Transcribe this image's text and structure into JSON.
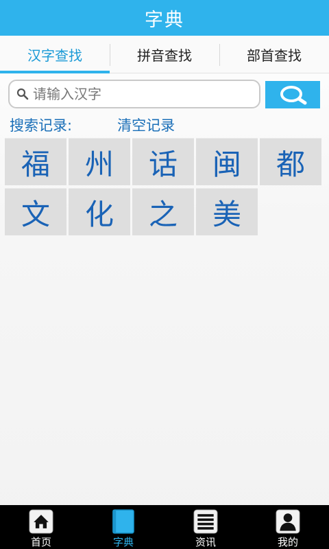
{
  "header": {
    "title": "字典"
  },
  "tabs": [
    {
      "label": "汉字查找",
      "active": true
    },
    {
      "label": "拼音查找",
      "active": false
    },
    {
      "label": "部首查找",
      "active": false
    }
  ],
  "search": {
    "placeholder": "请输入汉字",
    "value": ""
  },
  "history": {
    "label": "搜索记录:",
    "clear_label": "清空记录",
    "items": [
      "福",
      "州",
      "话",
      "闽",
      "都",
      "文",
      "化",
      "之",
      "美"
    ]
  },
  "bottom_nav": [
    {
      "label": "首页",
      "icon": "home-icon",
      "active": false
    },
    {
      "label": "字典",
      "icon": "dictionary-icon",
      "active": true
    },
    {
      "label": "资讯",
      "icon": "news-icon",
      "active": false
    },
    {
      "label": "我的",
      "icon": "user-icon",
      "active": false
    }
  ],
  "colors": {
    "accent": "#2fb3ec",
    "char": "#1a63b6",
    "link": "#1a6fb8"
  }
}
